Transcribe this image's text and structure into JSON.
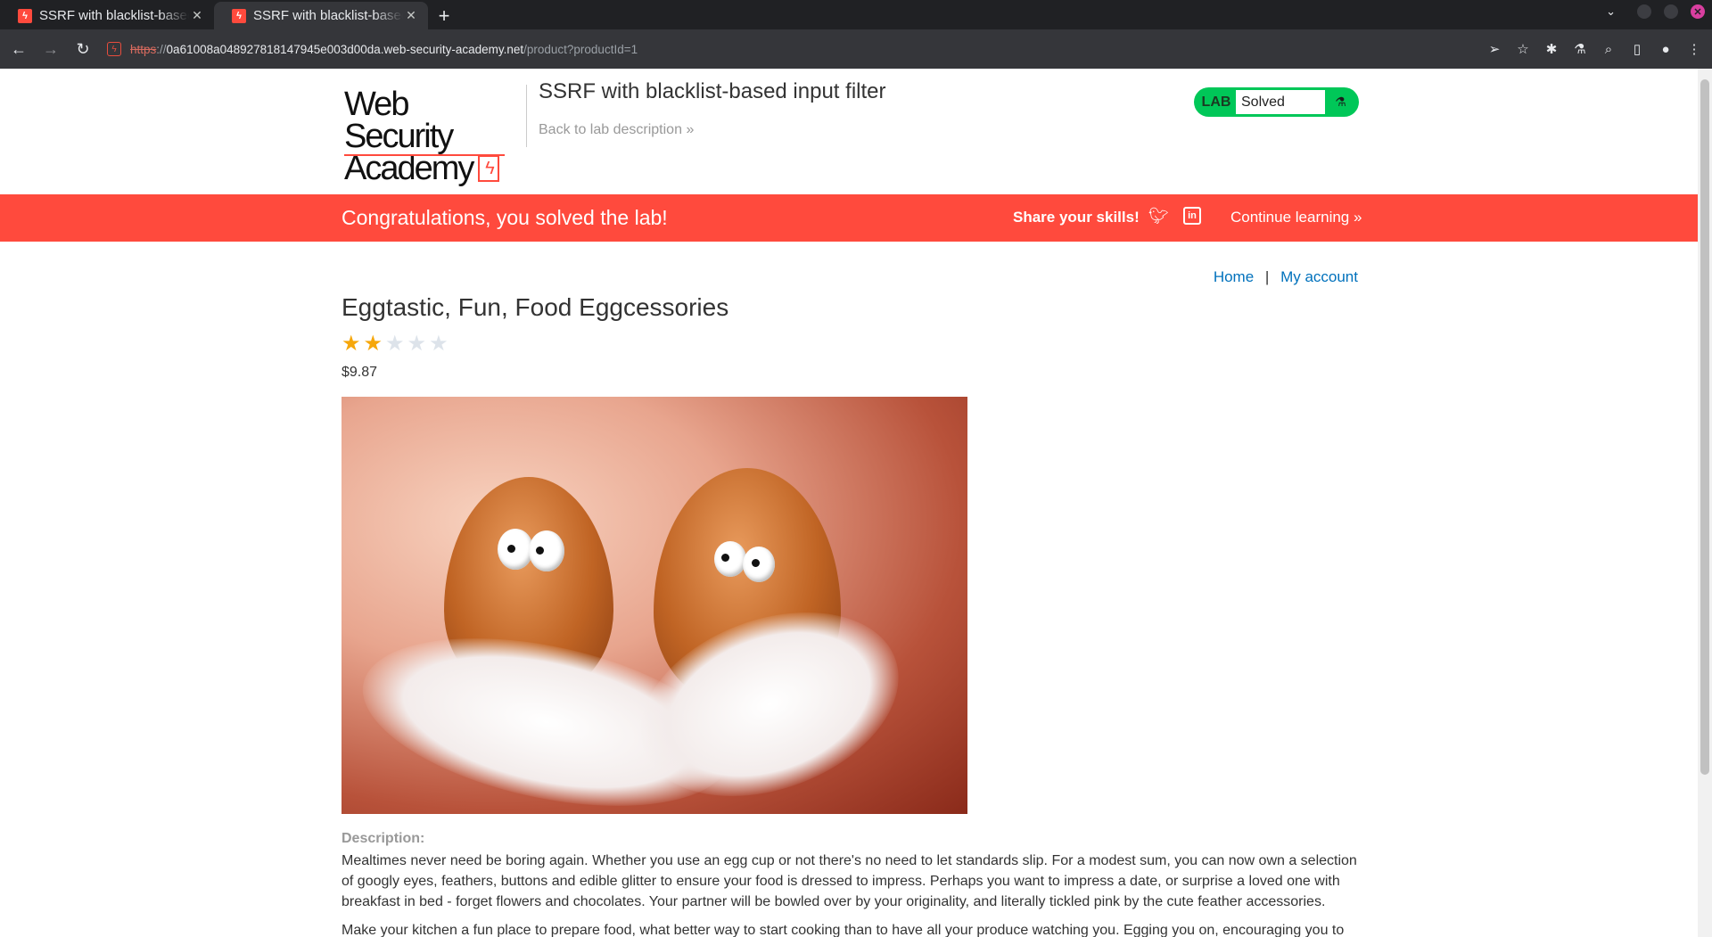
{
  "browser": {
    "tabs": [
      {
        "title": "SSRF with blacklist-based input filter",
        "active": false
      },
      {
        "title": "SSRF with blacklist-based input filter",
        "active": true
      }
    ],
    "new_tab": "+",
    "url": {
      "scheme": "https",
      "sep": "://",
      "host": "0a61008a048927818147945e003d00da.web-security-academy.net",
      "path": "/product?productId=1"
    }
  },
  "header": {
    "logo_line1": "Web Security",
    "logo_line2": "Academy",
    "lab_title": "SSRF with blacklist-based input filter",
    "back_link": "Back to lab description",
    "badge_label": "LAB",
    "badge_status": "Solved"
  },
  "banner": {
    "message": "Congratulations, you solved the lab!",
    "share": "Share your skills!",
    "continue": "Continue learning"
  },
  "nav": {
    "home": "Home",
    "separator": "|",
    "account": "My account"
  },
  "product": {
    "title": "Eggtastic, Fun, Food Eggcessories",
    "rating": 2,
    "rating_max": 5,
    "price": "$9.87",
    "description_label": "Description:",
    "description_p1": "Mealtimes never need be boring again. Whether you use an egg cup or not there's no need to let standards slip. For a modest sum, you can now own a selection of googly eyes, feathers, buttons and edible glitter to ensure your food is dressed to impress. Perhaps you want to impress a date, or surprise a loved one with breakfast in bed - forget flowers and chocolates. Your partner will be bowled over by your originality, and literally tickled pink by the cute feather accessories.",
    "description_p2": "Make your kitchen a fun place to prepare food, what better way to start cooking than to have all your produce watching you. Egging you on, encouraging you to"
  },
  "colors": {
    "accent": "#ff4a3d",
    "solved": "#00c758",
    "link": "#0071bc",
    "star_on": "#f6a70b"
  }
}
